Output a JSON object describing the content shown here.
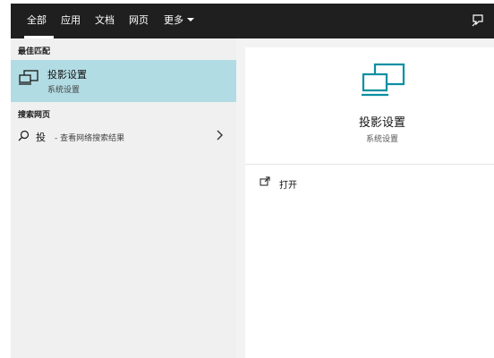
{
  "tabs": [
    {
      "label": "全部",
      "active": true
    },
    {
      "label": "应用",
      "active": false
    },
    {
      "label": "文档",
      "active": false
    },
    {
      "label": "网页",
      "active": false
    },
    {
      "label": "更多",
      "active": false
    }
  ],
  "sections": {
    "best_match": "最佳匹配",
    "web_search": "搜索网页"
  },
  "best_match_result": {
    "title": "投影设置",
    "subtitle": "系统设置",
    "icon": "display-project-icon"
  },
  "web_result": {
    "term": "投",
    "description": "- 查看网络搜索结果",
    "icon": "search-icon"
  },
  "preview": {
    "title": "投影设置",
    "subtitle": "系统设置",
    "icon": "display-project-icon"
  },
  "actions": [
    {
      "label": "打开",
      "icon": "open-icon"
    }
  ],
  "colors": {
    "topbar": "#1f1f1f",
    "selected": "#b2dce4",
    "accent": "#0a8fa3",
    "pane": "#f0f0f0"
  }
}
